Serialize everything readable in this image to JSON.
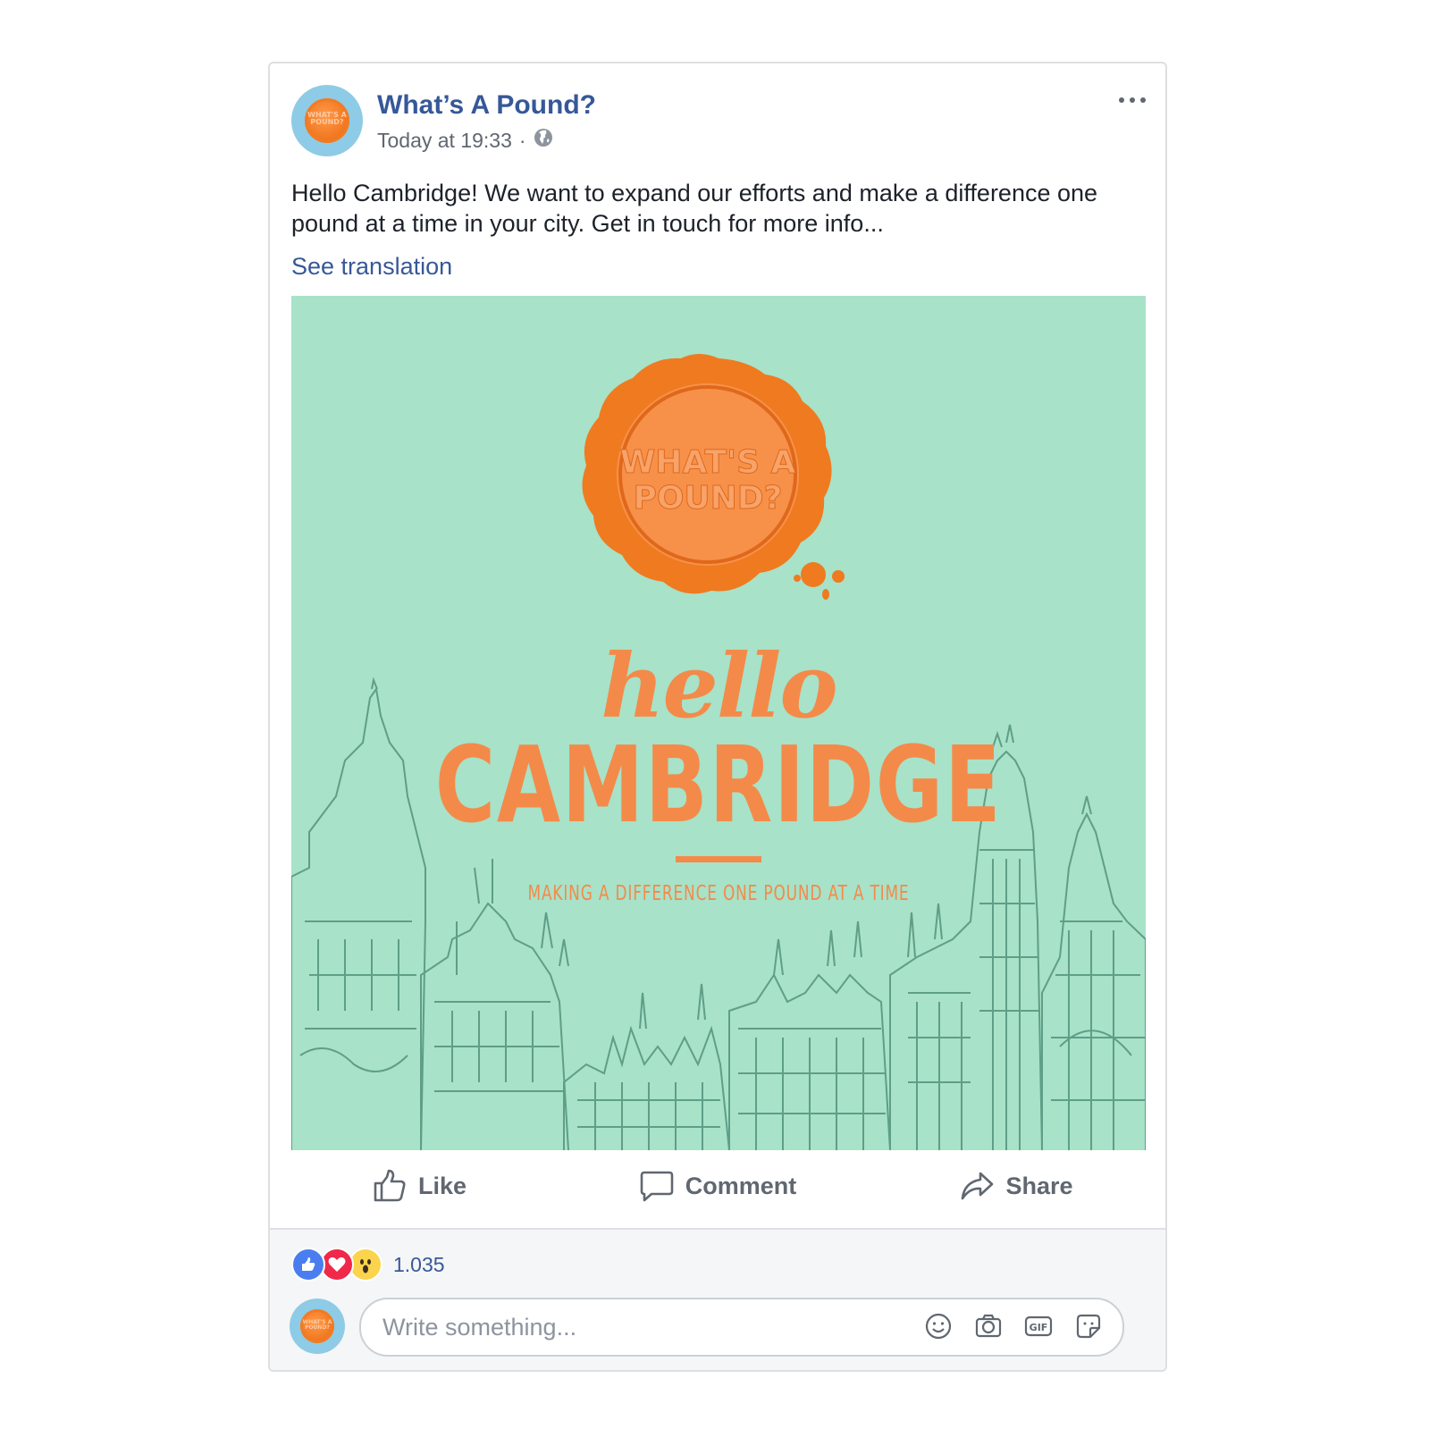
{
  "post": {
    "page_name": "What’s A Pound?",
    "timestamp": "Today at 19:33",
    "separator": "·",
    "privacy_icon": "globe-icon",
    "more_icon": "more-horizontal-icon",
    "text": "Hello Cambridge! We want to expand our efforts and make a difference one pound at a time in your city. Get in touch for more info...",
    "see_translation": "See translation"
  },
  "logo": {
    "line1": "WHAT'S A",
    "line2": "POUND?"
  },
  "image": {
    "script_word": "hello",
    "headline": "CAMBRIDGE",
    "tagline": "MAKING A DIFFERENCE ONE POUND AT A TIME",
    "background_color": "#a8e2c8",
    "accent_color": "#f48a4a"
  },
  "actions": {
    "like": "Like",
    "comment": "Comment",
    "share": "Share"
  },
  "reactions": {
    "icons": [
      "like-reaction-icon",
      "love-reaction-icon",
      "wow-reaction-icon"
    ],
    "count": "1.035"
  },
  "composer": {
    "placeholder": "Write something...",
    "icons": [
      "emoji-icon",
      "camera-icon",
      "gif-icon",
      "sticker-icon"
    ]
  }
}
